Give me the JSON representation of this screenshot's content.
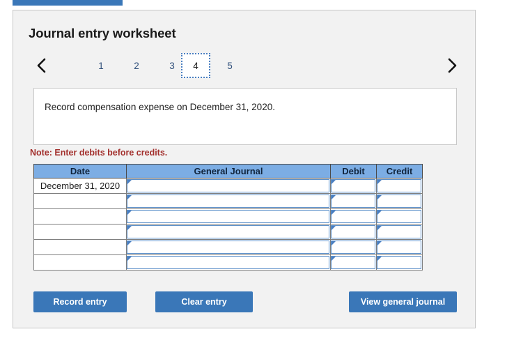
{
  "colors": {
    "brand_blue": "#3a77b8",
    "table_header_blue": "#7cade4",
    "panel_bg": "#f2f2f2",
    "note_red": "#a22f2c",
    "entry_border_blue": "#5b8fc9"
  },
  "panel": {
    "title": "Journal entry worksheet"
  },
  "pager": {
    "prev_icon": "chevron-left-icon",
    "next_icon": "chevron-right-icon",
    "tabs": [
      {
        "label": "1",
        "active": false
      },
      {
        "label": "2",
        "active": false
      },
      {
        "label": "3",
        "active": false
      },
      {
        "label": "4",
        "active": true
      },
      {
        "label": "5",
        "active": false
      }
    ]
  },
  "description": {
    "text": "Record compensation expense on December 31, 2020."
  },
  "note": {
    "text": "Note: Enter debits before credits."
  },
  "table": {
    "headers": [
      "Date",
      "General Journal",
      "Debit",
      "Credit"
    ],
    "rows": [
      {
        "date": "December 31, 2020",
        "general_journal": "",
        "debit": "",
        "credit": ""
      },
      {
        "date": "",
        "general_journal": "",
        "debit": "",
        "credit": ""
      },
      {
        "date": "",
        "general_journal": "",
        "debit": "",
        "credit": ""
      },
      {
        "date": "",
        "general_journal": "",
        "debit": "",
        "credit": ""
      },
      {
        "date": "",
        "general_journal": "",
        "debit": "",
        "credit": ""
      },
      {
        "date": "",
        "general_journal": "",
        "debit": "",
        "credit": ""
      }
    ]
  },
  "actions": {
    "record_entry": "Record entry",
    "clear_entry": "Clear entry",
    "view_general_journal": "View general journal"
  }
}
